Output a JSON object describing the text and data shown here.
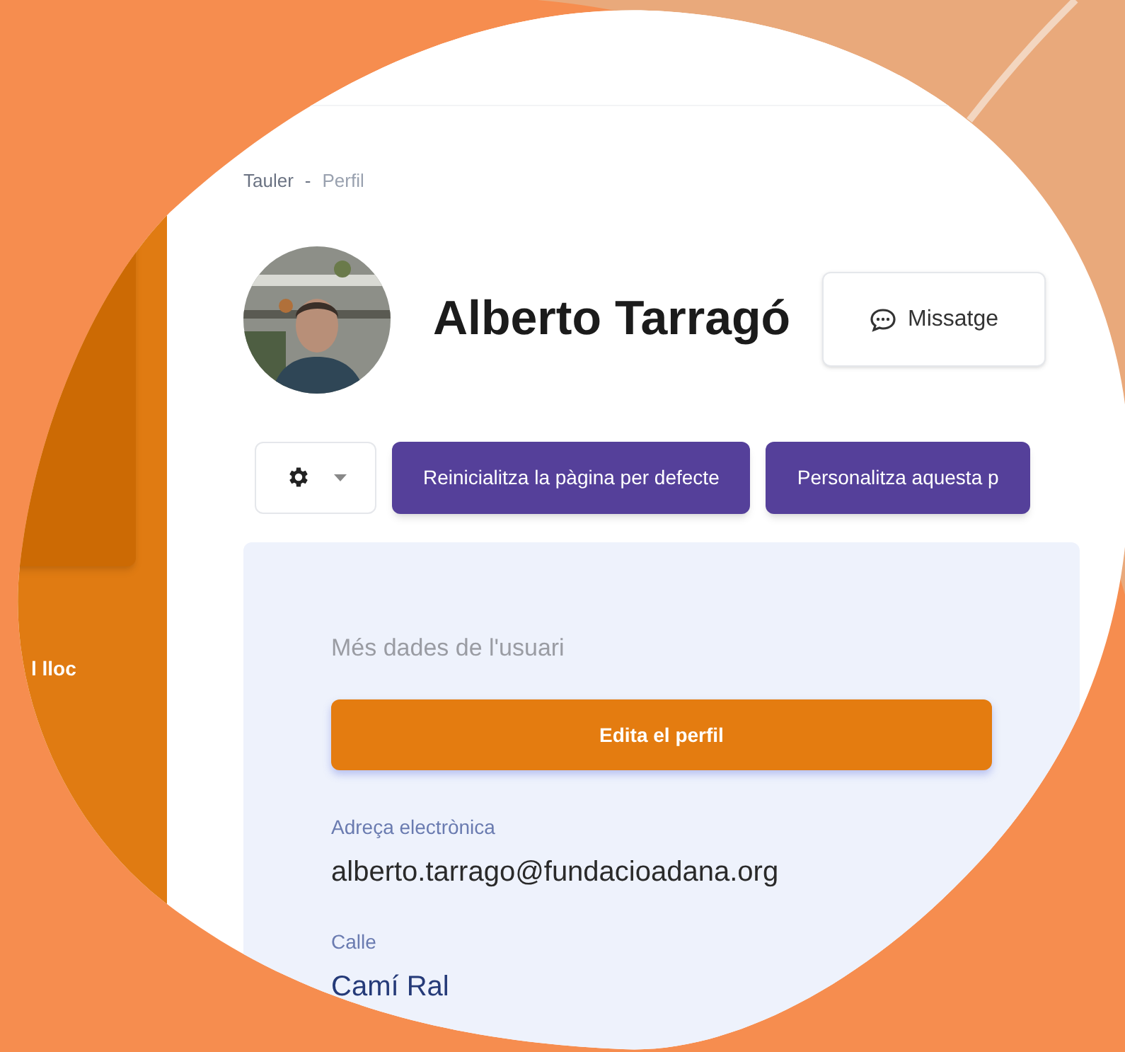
{
  "sidebar": {
    "items": [
      {
        "label": "l lloc"
      }
    ]
  },
  "breadcrumb": [
    "Tauler",
    "-",
    "Perfil"
  ],
  "profile": {
    "name": "Alberto Tarragó",
    "message_button": "Missatge"
  },
  "toolbar": {
    "buttons": [
      "Reinicialitza la pàgina per defecte",
      "Personalitza aquesta p"
    ]
  },
  "card": {
    "title": "Més dades de l'usuari",
    "edit_button": "Edita el perfil",
    "fields": [
      {
        "label": "Adreça electrònica",
        "value": "alberto.tarrago@fundacioadana.org",
        "kind": "email"
      },
      {
        "label": "Calle",
        "value": "Camí Ral",
        "kind": "text"
      }
    ]
  }
}
